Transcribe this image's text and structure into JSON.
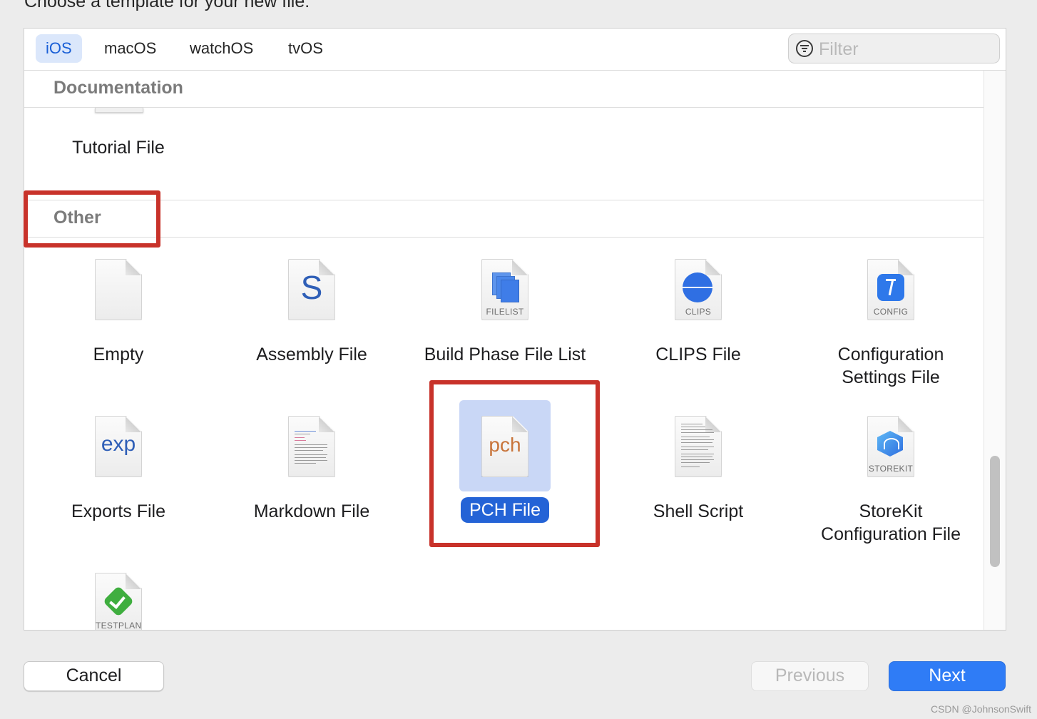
{
  "dialog": {
    "heading": "Choose a template for your new file:"
  },
  "platform_tabs": [
    {
      "label": "iOS",
      "selected": true
    },
    {
      "label": "macOS",
      "selected": false
    },
    {
      "label": "watchOS",
      "selected": false
    },
    {
      "label": "tvOS",
      "selected": false
    }
  ],
  "filter": {
    "placeholder": "Filter",
    "value": ""
  },
  "sections": {
    "documentation": {
      "title": "Documentation",
      "items": [
        {
          "label": "Tutorial File"
        }
      ]
    },
    "other": {
      "title": "Other",
      "items": [
        {
          "label": "Empty",
          "icon": "blank-file-icon"
        },
        {
          "label": "Assembly File",
          "icon": "assembly-file-icon",
          "glyph": "S"
        },
        {
          "label": "Build Phase File List",
          "icon": "filelist-file-icon",
          "tag": "FILELIST"
        },
        {
          "label": "CLIPS File",
          "icon": "clips-file-icon",
          "tag": "CLIPS"
        },
        {
          "label": "Configuration Settings File",
          "icon": "config-file-icon",
          "tag": "CONFIG"
        },
        {
          "label": "Exports File",
          "icon": "exports-file-icon",
          "glyph": "exp"
        },
        {
          "label": "Markdown File",
          "icon": "markdown-file-icon"
        },
        {
          "label": "PCH File",
          "icon": "pch-file-icon",
          "glyph": "pch",
          "selected": true
        },
        {
          "label": "Shell Script",
          "icon": "shell-script-file-icon"
        },
        {
          "label": "StoreKit Configuration File",
          "icon": "storekit-file-icon",
          "tag": "STOREKIT"
        },
        {
          "label": "",
          "icon": "testplan-file-icon",
          "tag": "TESTPLAN"
        }
      ]
    }
  },
  "buttons": {
    "cancel": "Cancel",
    "previous": "Previous",
    "next": "Next"
  },
  "watermark": "CSDN @JohnsonSwift",
  "colors": {
    "accent": "#2f7cf6",
    "selection": "#2463d6",
    "annotation_red": "#c8322a"
  }
}
